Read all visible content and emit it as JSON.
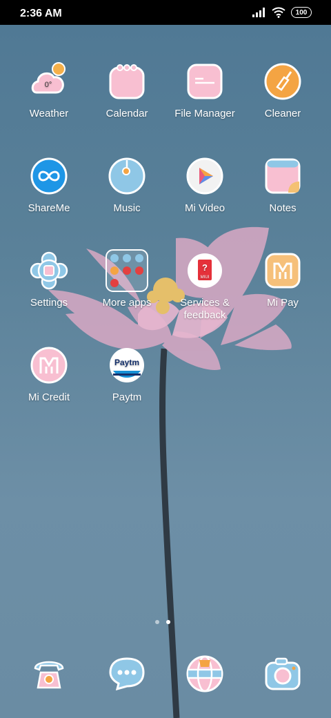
{
  "status_bar": {
    "time": "2:36 AM",
    "battery": "100"
  },
  "apps": [
    {
      "id": "weather",
      "label": "Weather",
      "icon": "weather-icon",
      "badge": "0°"
    },
    {
      "id": "calendar",
      "label": "Calendar",
      "icon": "calendar-icon"
    },
    {
      "id": "file-manager",
      "label": "File Manager",
      "icon": "folder-icon"
    },
    {
      "id": "cleaner",
      "label": "Cleaner",
      "icon": "broom-icon"
    },
    {
      "id": "shareme",
      "label": "ShareMe",
      "icon": "infinity-icon"
    },
    {
      "id": "music",
      "label": "Music",
      "icon": "music-disc-icon"
    },
    {
      "id": "mi-video",
      "label": "Mi Video",
      "icon": "play-icon"
    },
    {
      "id": "notes",
      "label": "Notes",
      "icon": "notes-icon"
    },
    {
      "id": "settings",
      "label": "Settings",
      "icon": "gear-icon"
    },
    {
      "id": "more-apps",
      "label": "More apps",
      "icon": "folder-grid-icon"
    },
    {
      "id": "services-feedback",
      "label": "Services & feedback",
      "icon": "help-bag-icon",
      "badge": "MIUI"
    },
    {
      "id": "mi-pay",
      "label": "Mi Pay",
      "icon": "mi-pay-icon"
    },
    {
      "id": "mi-credit",
      "label": "Mi Credit",
      "icon": "mi-credit-icon"
    },
    {
      "id": "paytm",
      "label": "Paytm",
      "icon": "paytm-icon",
      "badge": "Paytm"
    }
  ],
  "dock": [
    {
      "id": "phone",
      "icon": "phone-icon"
    },
    {
      "id": "messages",
      "icon": "message-icon"
    },
    {
      "id": "browser",
      "icon": "globe-icon"
    },
    {
      "id": "camera",
      "icon": "camera-icon"
    }
  ],
  "pager": {
    "pages": 2,
    "active": 2
  },
  "colors": {
    "pink": "#f8bfd1",
    "blue": "#8fc7e6",
    "orange": "#f4a443",
    "white": "#ffffff"
  }
}
